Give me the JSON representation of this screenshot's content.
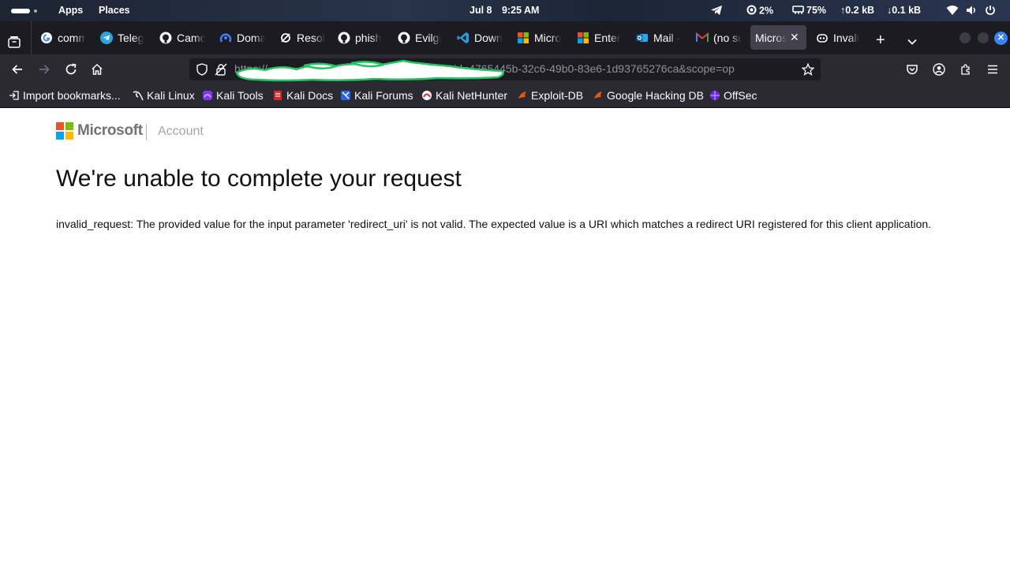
{
  "system_bar": {
    "apps_label": "Apps",
    "places_label": "Places",
    "date": "Jul 8",
    "time": "9:25 AM",
    "cpu": "2%",
    "memory": "75%",
    "upload": "0.2 kB",
    "download": "0.1 kB"
  },
  "tabs": [
    {
      "label": "comm",
      "icon": "google-icon"
    },
    {
      "label": "Teleg",
      "icon": "telegram-icon"
    },
    {
      "label": "Camo",
      "icon": "github-icon"
    },
    {
      "label": "Doma",
      "icon": "domain-icon"
    },
    {
      "label": "Resol",
      "icon": "resolve-icon"
    },
    {
      "label": "phish",
      "icon": "github-icon"
    },
    {
      "label": "Evilgi",
      "icon": "github-icon"
    },
    {
      "label": "Down",
      "icon": "vscode-icon"
    },
    {
      "label": "Micro",
      "icon": "microsoft-icon"
    },
    {
      "label": "Enter",
      "icon": "microsoft-icon"
    },
    {
      "label": "Mail -",
      "icon": "outlook-icon"
    },
    {
      "label": "(no su",
      "icon": "gmail-icon"
    },
    {
      "label": "Micros",
      "icon": "none",
      "active": true
    },
    {
      "label": "Invali",
      "icon": "copilot-icon"
    }
  ],
  "address_bar": {
    "url_visible": "https://••••••••••••••••••••••••••••••••••••••&client_id=4765445b-32c6-49b0-83e6-1d93765276ca&scope=op"
  },
  "bookmarks": [
    {
      "label": "Import bookmarks...",
      "icon": "import-icon"
    },
    {
      "label": "Kali Linux",
      "icon": "kali-icon"
    },
    {
      "label": "Kali Tools",
      "icon": "kali-tools-icon"
    },
    {
      "label": "Kali Docs",
      "icon": "kali-docs-icon"
    },
    {
      "label": "Kali Forums",
      "icon": "kali-forums-icon"
    },
    {
      "label": "Kali NetHunter",
      "icon": "nethunter-icon"
    },
    {
      "label": "Exploit-DB",
      "icon": "exploitdb-icon"
    },
    {
      "label": "Google Hacking DB",
      "icon": "ghdb-icon"
    },
    {
      "label": "OffSec",
      "icon": "offsec-icon"
    }
  ],
  "page": {
    "brand": "Microsoft",
    "section": "Account",
    "heading": "We're unable to complete your request",
    "error": "invalid_request: The provided value for the input parameter 'redirect_uri' is not valid. The expected value is a URI which matches a redirect URI registered for this client application."
  },
  "colors": {
    "ms_red": "#f25022",
    "ms_green": "#7fba00",
    "ms_blue": "#00a4ef",
    "ms_yellow": "#ffb900",
    "redaction": "#22c55e"
  }
}
